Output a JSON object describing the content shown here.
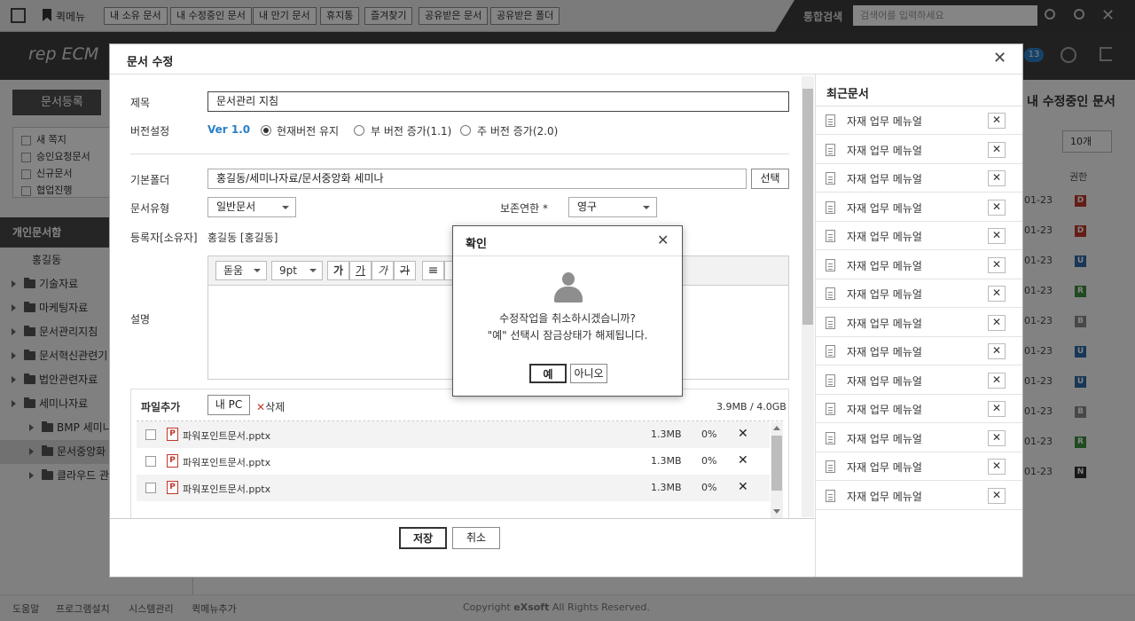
{
  "topbar": {
    "quick_menu": "퀵메뉴",
    "buttons": [
      "내 소유 문서",
      "내 수정중인 문서",
      "내 만기 문서",
      "휴지통",
      "즐겨찾기",
      "공유받은 문서",
      "공유받은 폴더"
    ],
    "search_label": "통합검색",
    "search_placeholder": "검색어를 입력하세요"
  },
  "header": {
    "logo": "rep ECM",
    "notice_count": "13"
  },
  "sidebar": {
    "register_btn": "문서등록",
    "checks": [
      "새 쪽지",
      "승인요청문서",
      "신규문서",
      "협업진행"
    ],
    "section_title": "개인문서함",
    "user": "홍길동",
    "folders": [
      "기술자료",
      "마케팅자료",
      "문서관리지침",
      "문서혁신관련기",
      "법안관련자료",
      "세미나자료"
    ],
    "subfolders": [
      "BMP 세미나",
      "문서중앙화",
      "클라우드 관"
    ]
  },
  "background_panel": {
    "title": "내 수정중인 문서",
    "page_size": "10개",
    "col_perm": "권한",
    "dates": [
      "01-23",
      "01-23",
      "01-23",
      "01-23",
      "01-23",
      "01-23",
      "01-23",
      "01-23",
      "01-23",
      "01-23"
    ],
    "badges": [
      "D",
      "D",
      "U",
      "R",
      "B",
      "U",
      "U",
      "B",
      "R",
      "N"
    ],
    "badge_colors": [
      "#c0392b",
      "#c0392b",
      "#2e6aa6",
      "#3f8f3f",
      "#8a8a8a",
      "#2e6aa6",
      "#2e6aa6",
      "#8a8a8a",
      "#3f8f3f",
      "#2f2f2f"
    ]
  },
  "footer": {
    "links": [
      "도움말",
      "프로그램설치",
      "시스템관리",
      "퀵메뉴추가"
    ],
    "copyright_pre": "Copyright ",
    "brand": "eXsoft",
    "copyright_post": " All Rights Reserved."
  },
  "modal": {
    "title": "문서 수정",
    "title_label": "제목",
    "title_value": "문서관리 지침",
    "version_label": "버전설정",
    "version_value": "Ver 1.0",
    "version_options": [
      "현재버전 유지",
      "부 버전 증가(1.1)",
      "주 버전 증가(2.0)"
    ],
    "folder_label": "기본폴더",
    "folder_value": "홍길동/세미나자료/문서중앙화 세미나",
    "select_btn": "선택",
    "doctype_label": "문서유형",
    "doctype_value": "일반문서",
    "retention_label": "보존연한 *",
    "retention_value": "영구",
    "owner_label": "등록자[소유자]",
    "owner_value": "홍길동 [홍길동]",
    "desc_label": "설명",
    "editor": {
      "font": "돋움",
      "size": "9pt",
      "btns": [
        "가",
        "가",
        "가",
        "가"
      ]
    },
    "files": {
      "label": "파일추가",
      "pc_btn": "내 PC",
      "delete_btn": "삭제",
      "quota": "3.9MB / 4.0GB",
      "rows": [
        {
          "name": "파워포인트문서.pptx",
          "size": "1.3MB",
          "progress": "0%"
        },
        {
          "name": "파워포인트문서.pptx",
          "size": "1.3MB",
          "progress": "0%"
        },
        {
          "name": "파워포인트문서.pptx",
          "size": "1.3MB",
          "progress": "0%"
        }
      ]
    },
    "save_btn": "저장",
    "cancel_btn": "취소",
    "recent_title": "최근문서",
    "recent": [
      "자재 업무 메뉴얼",
      "자재 업무 메뉴얼",
      "자재 업무 메뉴얼",
      "자재 업무 메뉴얼",
      "자재 업무 메뉴얼",
      "자재 업무 메뉴얼",
      "자재 업무 메뉴얼",
      "자재 업무 메뉴얼",
      "자재 업무 메뉴얼",
      "자재 업무 메뉴얼",
      "자재 업무 메뉴얼",
      "자재 업무 메뉴얼",
      "자재 업무 메뉴얼",
      "자재 업무 메뉴얼"
    ]
  },
  "confirm": {
    "title": "확인",
    "line1": "수정작업을 취소하시겠습니까?",
    "line2": "\"예\" 선택시 잠금상태가 해제됩니다.",
    "yes": "예",
    "no": "아니오"
  }
}
